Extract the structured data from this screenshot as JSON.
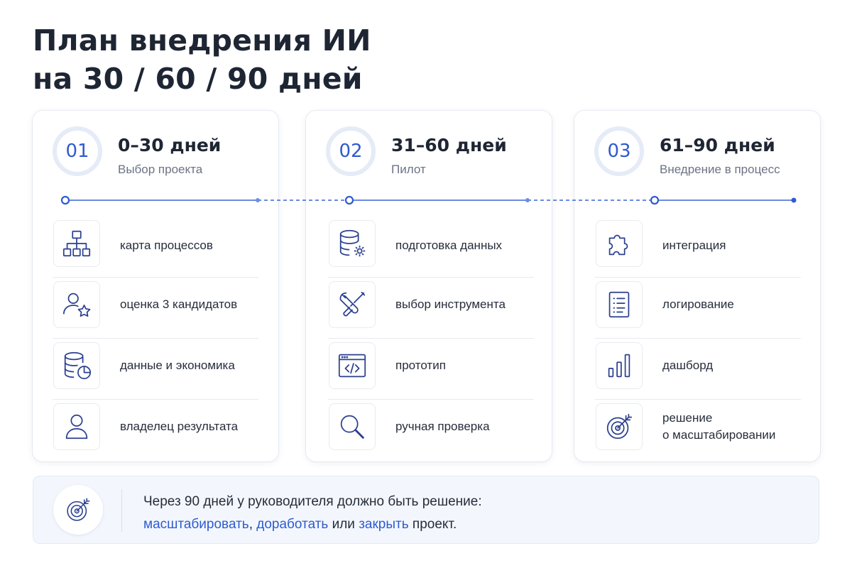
{
  "title": {
    "line1": "План внедрения ИИ",
    "line2": "на 30 / 60 / 90 дней"
  },
  "stages": [
    {
      "number": "01",
      "title": "0–30 дней",
      "subtitle": "Выбор проекта",
      "items": [
        {
          "icon": "process-map-icon",
          "label": "карта процессов"
        },
        {
          "icon": "user-star-icon",
          "label": "оценка 3 кандидатов"
        },
        {
          "icon": "database-chart-icon",
          "label": "данные и экономика"
        },
        {
          "icon": "user-icon",
          "label": "владелец результата"
        }
      ]
    },
    {
      "number": "02",
      "title": "31–60 дней",
      "subtitle": "Пилот",
      "items": [
        {
          "icon": "database-gear-icon",
          "label": "подготовка данных"
        },
        {
          "icon": "tools-icon",
          "label": "выбор инструмента"
        },
        {
          "icon": "code-window-icon",
          "label": "прототип"
        },
        {
          "icon": "magnifier-icon",
          "label": "ручная проверка"
        }
      ]
    },
    {
      "number": "03",
      "title": "61–90 дней",
      "subtitle": "Внедрение в процесс",
      "items": [
        {
          "icon": "puzzle-icon",
          "label": "интеграция"
        },
        {
          "icon": "document-list-icon",
          "label": "логирование"
        },
        {
          "icon": "bar-chart-icon",
          "label": "дашборд"
        },
        {
          "icon": "target-icon",
          "label": "решение\nо масштабировании"
        }
      ]
    }
  ],
  "footer": {
    "icon": "target-icon",
    "line1": "Через 90 дней у руководителя должно быть решение:",
    "scale": "масштабировать",
    "sep1": ", ",
    "refine": "доработать",
    "sep2": " или ",
    "close": "закрыть",
    "end": " проект."
  },
  "colors": {
    "accent": "#2f5bd0",
    "text": "#1e2533",
    "muted": "#6b7384",
    "icon_stroke": "#2b3f8f"
  }
}
